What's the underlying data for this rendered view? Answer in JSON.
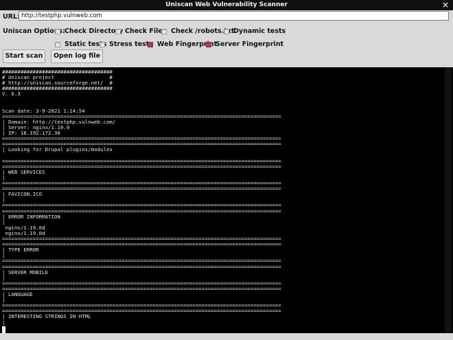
{
  "window": {
    "title": "Uniscan Web Vulnerability Scanner",
    "close_glyph": "×"
  },
  "url": {
    "label": "URL:",
    "value": "http://testphp.vulnweb.com"
  },
  "options": {
    "label": "Uniscan Options:",
    "items": [
      {
        "label": "Check Directory",
        "checked": false
      },
      {
        "label": "Check Files",
        "checked": false
      },
      {
        "label": "Check /robots.txt",
        "checked": false
      },
      {
        "label": "Dynamic tests",
        "checked": false
      },
      {
        "label": "Static tests",
        "checked": false
      },
      {
        "label": "Stress tests",
        "checked": false
      },
      {
        "label": "Web Fingerprint",
        "checked": true
      },
      {
        "label": "Server Fingerprint",
        "checked": true
      }
    ]
  },
  "buttons": {
    "start": "Start scan",
    "log": "Open log file"
  },
  "console": {
    "lines": [
      "####################################",
      "# Uniscan project                  #",
      "# http://uniscan.sourceforge.net/  #",
      "####################################",
      "V. 6.3",
      "",
      "",
      "Scan date: 3-9-2021 1:14:54",
      "===========================================================================================",
      "| Domain: http://testphp.vulnweb.com/",
      "| Server: nginx/1.19.0",
      "| IP: 18.192.172.30",
      "===========================================================================================",
      "===========================================================================================",
      "| Looking for Drupal plugins/modules",
      "",
      "===========================================================================================",
      "===========================================================================================",
      "| WEB SERVICES",
      "|",
      "===========================================================================================",
      "===========================================================================================",
      "| FAVICON.ICO",
      "|",
      "===========================================================================================",
      "===========================================================================================",
      "| ERROR INFORMATION",
      "|",
      " nginx/1.19.0d",
      " nginx/1.19.0d",
      "===========================================================================================",
      "===========================================================================================",
      "| TYPE ERROR",
      "|",
      "===========================================================================================",
      "===========================================================================================",
      "| SERVER MOBILE",
      "|",
      "===========================================================================================",
      "===========================================================================================",
      "| LANGUAGE",
      "|",
      "===========================================================================================",
      "===========================================================================================",
      "| INTERESTING STRINGS IN HTML",
      "|"
    ]
  }
}
